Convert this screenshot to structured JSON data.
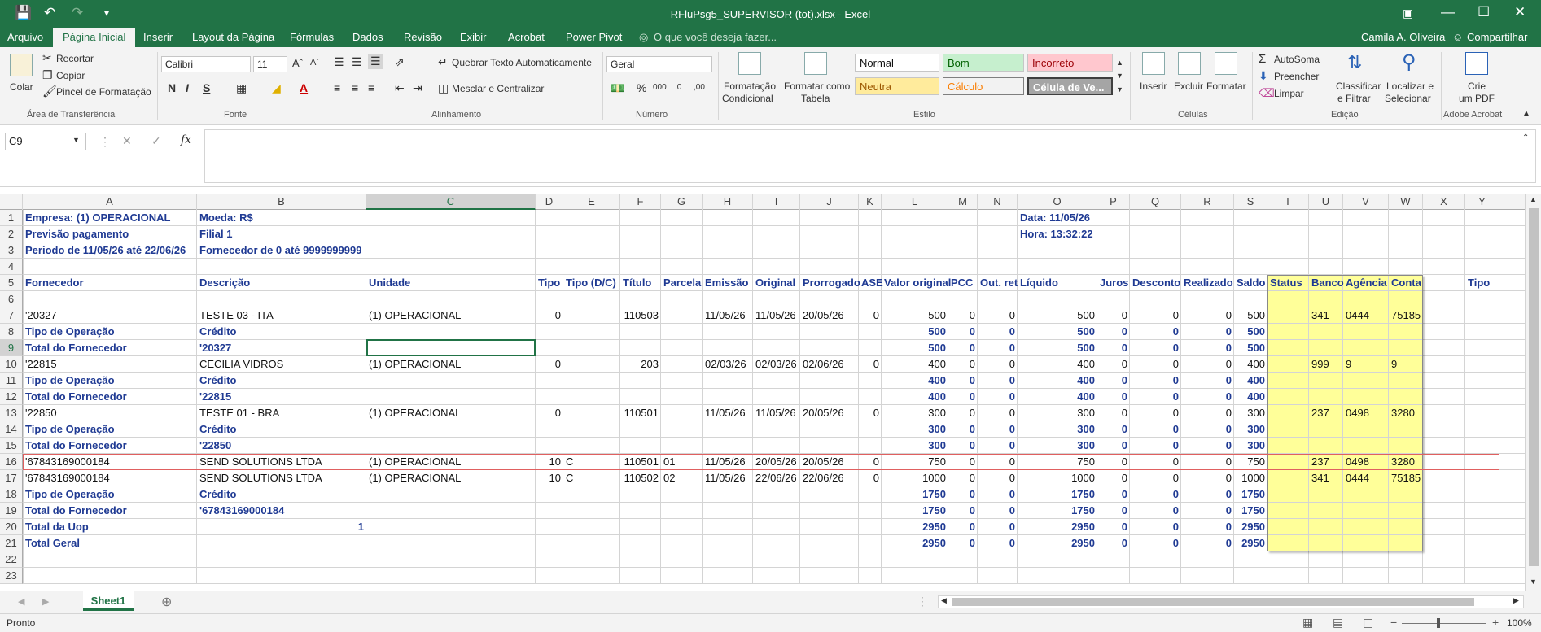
{
  "window": {
    "title": "RFluPsg5_SUPERVISOR (tot).xlsx - Excel"
  },
  "menu": {
    "tabs": [
      "Arquivo",
      "Página Inicial",
      "Inserir",
      "Layout da Página",
      "Fórmulas",
      "Dados",
      "Revisão",
      "Exibir",
      "Acrobat",
      "Power Pivot"
    ],
    "active_tab": "Página Inicial",
    "tell_me": "O que você deseja fazer...",
    "user": "Camila A. Oliveira",
    "share": "Compartilhar"
  },
  "ribbon": {
    "clipboard": {
      "paste": "Colar",
      "cut": "Recortar",
      "copy": "Copiar",
      "format_painter": "Pincel de Formatação",
      "label": "Área de Transferência"
    },
    "font": {
      "name": "Calibri",
      "size": "11",
      "label": "Fonte"
    },
    "alignment": {
      "wrap": "Quebrar Texto Automaticamente",
      "merge": "Mesclar e Centralizar",
      "label": "Alinhamento"
    },
    "number": {
      "format": "Geral",
      "label": "Número"
    },
    "styles": {
      "cond_format_1": "Formatação",
      "cond_format_2": "Condicional",
      "format_table_1": "Formatar como",
      "format_table_2": "Tabela",
      "normal": "Normal",
      "good": "Bom",
      "bad": "Incorreto",
      "neutral": "Neutra",
      "calc": "Cálculo",
      "check": "Célula de Ve...",
      "label": "Estilo"
    },
    "cells": {
      "insert": "Inserir",
      "delete": "Excluir",
      "format": "Formatar",
      "label": "Células"
    },
    "editing": {
      "autosum": "AutoSoma",
      "fill": "Preencher",
      "clear": "Limpar",
      "sort_1": "Classificar",
      "sort_2": "e Filtrar",
      "find_1": "Localizar e",
      "find_2": "Selecionar",
      "label": "Edição"
    },
    "acrobat": {
      "create_1": "Crie",
      "create_2": "um PDF",
      "label": "Adobe Acrobat"
    }
  },
  "formula_bar": {
    "name_box": "C9",
    "formula": ""
  },
  "columns": [
    "A",
    "B",
    "C",
    "D",
    "E",
    "F",
    "G",
    "H",
    "I",
    "J",
    "K",
    "L",
    "M",
    "N",
    "O",
    "P",
    "Q",
    "R",
    "S",
    "T",
    "U",
    "V",
    "W",
    "X",
    "Y"
  ],
  "rows": [
    "1",
    "2",
    "3",
    "4",
    "5",
    "6",
    "7",
    "8",
    "9",
    "10",
    "11",
    "12",
    "13",
    "14",
    "15",
    "16",
    "17",
    "18",
    "19",
    "20",
    "21",
    "22",
    "23"
  ],
  "cells": {
    "r1": {
      "a": "Empresa: (1) OPERACIONAL",
      "b": "Moeda: R$",
      "o": "Data: 11/05/26"
    },
    "r2": {
      "a": "Previsão pagamento",
      "b": "Filial 1",
      "o": "Hora: 13:32:22"
    },
    "r3": {
      "a": "Periodo de 11/05/26 até 22/06/26",
      "b": "Fornecedor de 0 até 9999999999"
    },
    "header": [
      "Fornecedor",
      "Descrição",
      "Unidade",
      "Tipo",
      "Tipo (D/C)",
      "Título",
      "Parcela",
      "Emissão",
      "Original",
      "Prorrogado",
      "ASE",
      "Valor original",
      "PCC",
      "Out. ret",
      "Líquido",
      "Juros",
      "Desconto",
      "Realizado",
      "Saldo",
      "Status",
      "Banco",
      "Agência",
      "Conta",
      "",
      "Tipo"
    ],
    "data": [
      {
        "row": 7,
        "bold": false,
        "v": [
          "'20327",
          "TESTE 03 - ITA",
          "(1) OPERACIONAL",
          "0",
          "",
          "110503",
          "",
          "11/05/26",
          "11/05/26",
          "20/05/26",
          "0",
          "500",
          "0",
          "0",
          "500",
          "0",
          "0",
          "0",
          "500",
          "",
          "341",
          "0444",
          "75185"
        ]
      },
      {
        "row": 8,
        "bold": true,
        "v": [
          "Tipo de Operação",
          "Crédito",
          "",
          "",
          "",
          "",
          "",
          "",
          "",
          "",
          "",
          "500",
          "0",
          "0",
          "500",
          "0",
          "0",
          "0",
          "500",
          "",
          "",
          "",
          ""
        ]
      },
      {
        "row": 9,
        "bold": true,
        "v": [
          "Total do Fornecedor",
          "'20327",
          "",
          "",
          "",
          "",
          "",
          "",
          "",
          "",
          "",
          "500",
          "0",
          "0",
          "500",
          "0",
          "0",
          "0",
          "500",
          "",
          "",
          "",
          ""
        ]
      },
      {
        "row": 10,
        "bold": false,
        "v": [
          "'22815",
          "CECILIA VIDROS",
          "(1) OPERACIONAL",
          "0",
          "",
          "203",
          "",
          "02/03/26",
          "02/03/26",
          "02/06/26",
          "0",
          "400",
          "0",
          "0",
          "400",
          "0",
          "0",
          "0",
          "400",
          "",
          "999",
          "9",
          "9"
        ]
      },
      {
        "row": 11,
        "bold": true,
        "v": [
          "Tipo de Operação",
          "Crédito",
          "",
          "",
          "",
          "",
          "",
          "",
          "",
          "",
          "",
          "400",
          "0",
          "0",
          "400",
          "0",
          "0",
          "0",
          "400",
          "",
          "",
          "",
          ""
        ]
      },
      {
        "row": 12,
        "bold": true,
        "v": [
          "Total do Fornecedor",
          "'22815",
          "",
          "",
          "",
          "",
          "",
          "",
          "",
          "",
          "",
          "400",
          "0",
          "0",
          "400",
          "0",
          "0",
          "0",
          "400",
          "",
          "",
          "",
          ""
        ]
      },
      {
        "row": 13,
        "bold": false,
        "v": [
          "'22850",
          "TESTE 01 - BRA",
          "(1) OPERACIONAL",
          "0",
          "",
          "110501",
          "",
          "11/05/26",
          "11/05/26",
          "20/05/26",
          "0",
          "300",
          "0",
          "0",
          "300",
          "0",
          "0",
          "0",
          "300",
          "",
          "237",
          "0498",
          "3280"
        ]
      },
      {
        "row": 14,
        "bold": true,
        "v": [
          "Tipo de Operação",
          "Crédito",
          "",
          "",
          "",
          "",
          "",
          "",
          "",
          "",
          "",
          "300",
          "0",
          "0",
          "300",
          "0",
          "0",
          "0",
          "300",
          "",
          "",
          "",
          ""
        ]
      },
      {
        "row": 15,
        "bold": true,
        "v": [
          "Total do Fornecedor",
          "'22850",
          "",
          "",
          "",
          "",
          "",
          "",
          "",
          "",
          "",
          "300",
          "0",
          "0",
          "300",
          "0",
          "0",
          "0",
          "300",
          "",
          "",
          "",
          ""
        ]
      },
      {
        "row": 16,
        "bold": false,
        "v": [
          "'67843169000184",
          "SEND SOLUTIONS LTDA",
          "(1) OPERACIONAL",
          "10",
          "C",
          "110501",
          "01",
          "11/05/26",
          "20/05/26",
          "20/05/26",
          "0",
          "750",
          "0",
          "0",
          "750",
          "0",
          "0",
          "0",
          "750",
          "",
          "237",
          "0498",
          "3280"
        ]
      },
      {
        "row": 17,
        "bold": false,
        "v": [
          "'67843169000184",
          "SEND SOLUTIONS LTDA",
          "(1) OPERACIONAL",
          "10",
          "C",
          "110502",
          "02",
          "11/05/26",
          "22/06/26",
          "22/06/26",
          "0",
          "1000",
          "0",
          "0",
          "1000",
          "0",
          "0",
          "0",
          "1000",
          "",
          "341",
          "0444",
          "75185"
        ]
      },
      {
        "row": 18,
        "bold": true,
        "v": [
          "Tipo de Operação",
          "Crédito",
          "",
          "",
          "",
          "",
          "",
          "",
          "",
          "",
          "",
          "1750",
          "0",
          "0",
          "1750",
          "0",
          "0",
          "0",
          "1750",
          "",
          "",
          "",
          ""
        ]
      },
      {
        "row": 19,
        "bold": true,
        "v": [
          "Total do Fornecedor",
          "'67843169000184",
          "",
          "",
          "",
          "",
          "",
          "",
          "",
          "",
          "",
          "1750",
          "0",
          "0",
          "1750",
          "0",
          "0",
          "0",
          "1750",
          "",
          "",
          "",
          ""
        ]
      },
      {
        "row": 20,
        "bold": true,
        "v": [
          "Total da Uop",
          "1",
          "",
          "",
          "",
          "",
          "",
          "",
          "",
          "",
          "",
          "2950",
          "0",
          "0",
          "2950",
          "0",
          "0",
          "0",
          "2950",
          "",
          "",
          "",
          ""
        ]
      },
      {
        "row": 21,
        "bold": true,
        "v": [
          "Total Geral",
          "",
          "",
          "",
          "",
          "",
          "",
          "",
          "",
          "",
          "",
          "2950",
          "0",
          "0",
          "2950",
          "0",
          "0",
          "0",
          "2950",
          "",
          "",
          "",
          ""
        ]
      }
    ]
  },
  "sheets": [
    "Sheet1"
  ],
  "status": {
    "ready": "Pronto",
    "zoom": "100%"
  },
  "colors": {
    "excel_green": "#217346",
    "highlight_yellow": "#ffff99",
    "bold_text": "#1f3a93",
    "row_outline": "#e06060"
  }
}
